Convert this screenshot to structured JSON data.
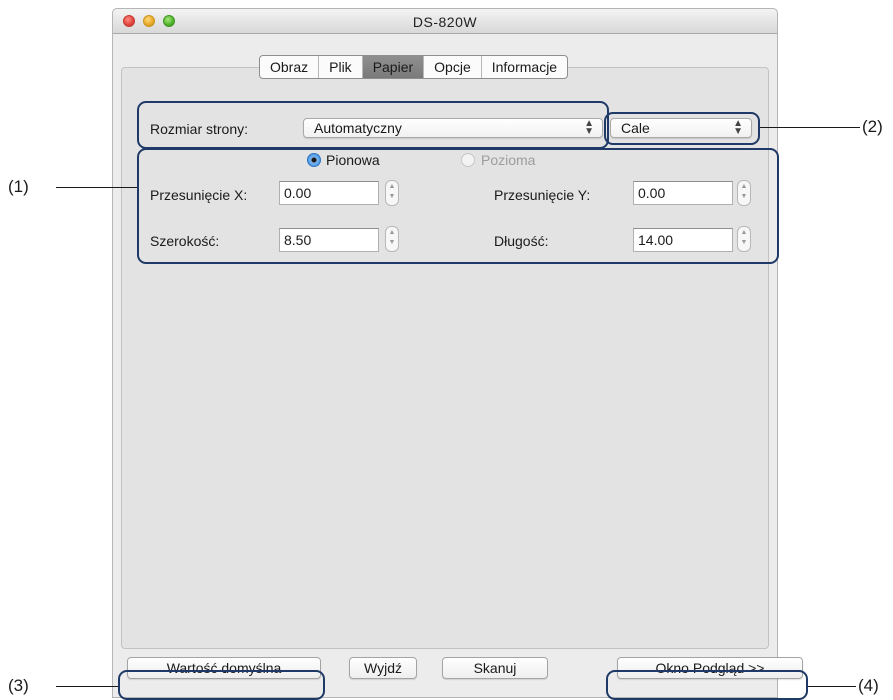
{
  "window": {
    "title": "DS-820W"
  },
  "tabs": [
    {
      "label": "Obraz",
      "active": false
    },
    {
      "label": "Plik",
      "active": false
    },
    {
      "label": "Papier",
      "active": true
    },
    {
      "label": "Opcje",
      "active": false
    },
    {
      "label": "Informacje",
      "active": false
    }
  ],
  "page_size": {
    "label": "Rozmiar strony:",
    "value": "Automatyczny"
  },
  "units": {
    "value": "Cale"
  },
  "orientation": {
    "portrait_label": "Pionowa",
    "portrait_selected": true,
    "landscape_label": "Pozioma",
    "landscape_selected": false
  },
  "offset_x": {
    "label": "Przesunięcie X:",
    "value": "0.00"
  },
  "offset_y": {
    "label": "Przesunięcie Y:",
    "value": "0.00"
  },
  "width": {
    "label": "Szerokość:",
    "value": "8.50"
  },
  "length": {
    "label": "Długość:",
    "value": "14.00"
  },
  "buttons": {
    "default": "Wartość domyślna",
    "exit": "Wyjdź",
    "scan": "Skanuj",
    "preview": "Okno Podgląd >>"
  },
  "callouts": {
    "c1": "(1)",
    "c2": "(2)",
    "c3": "(3)",
    "c4": "(4)"
  },
  "colors": {
    "highlight": "#1f3a66",
    "selected_tab": "#7f7f7f",
    "radio_selected": "#3d8fe0"
  }
}
